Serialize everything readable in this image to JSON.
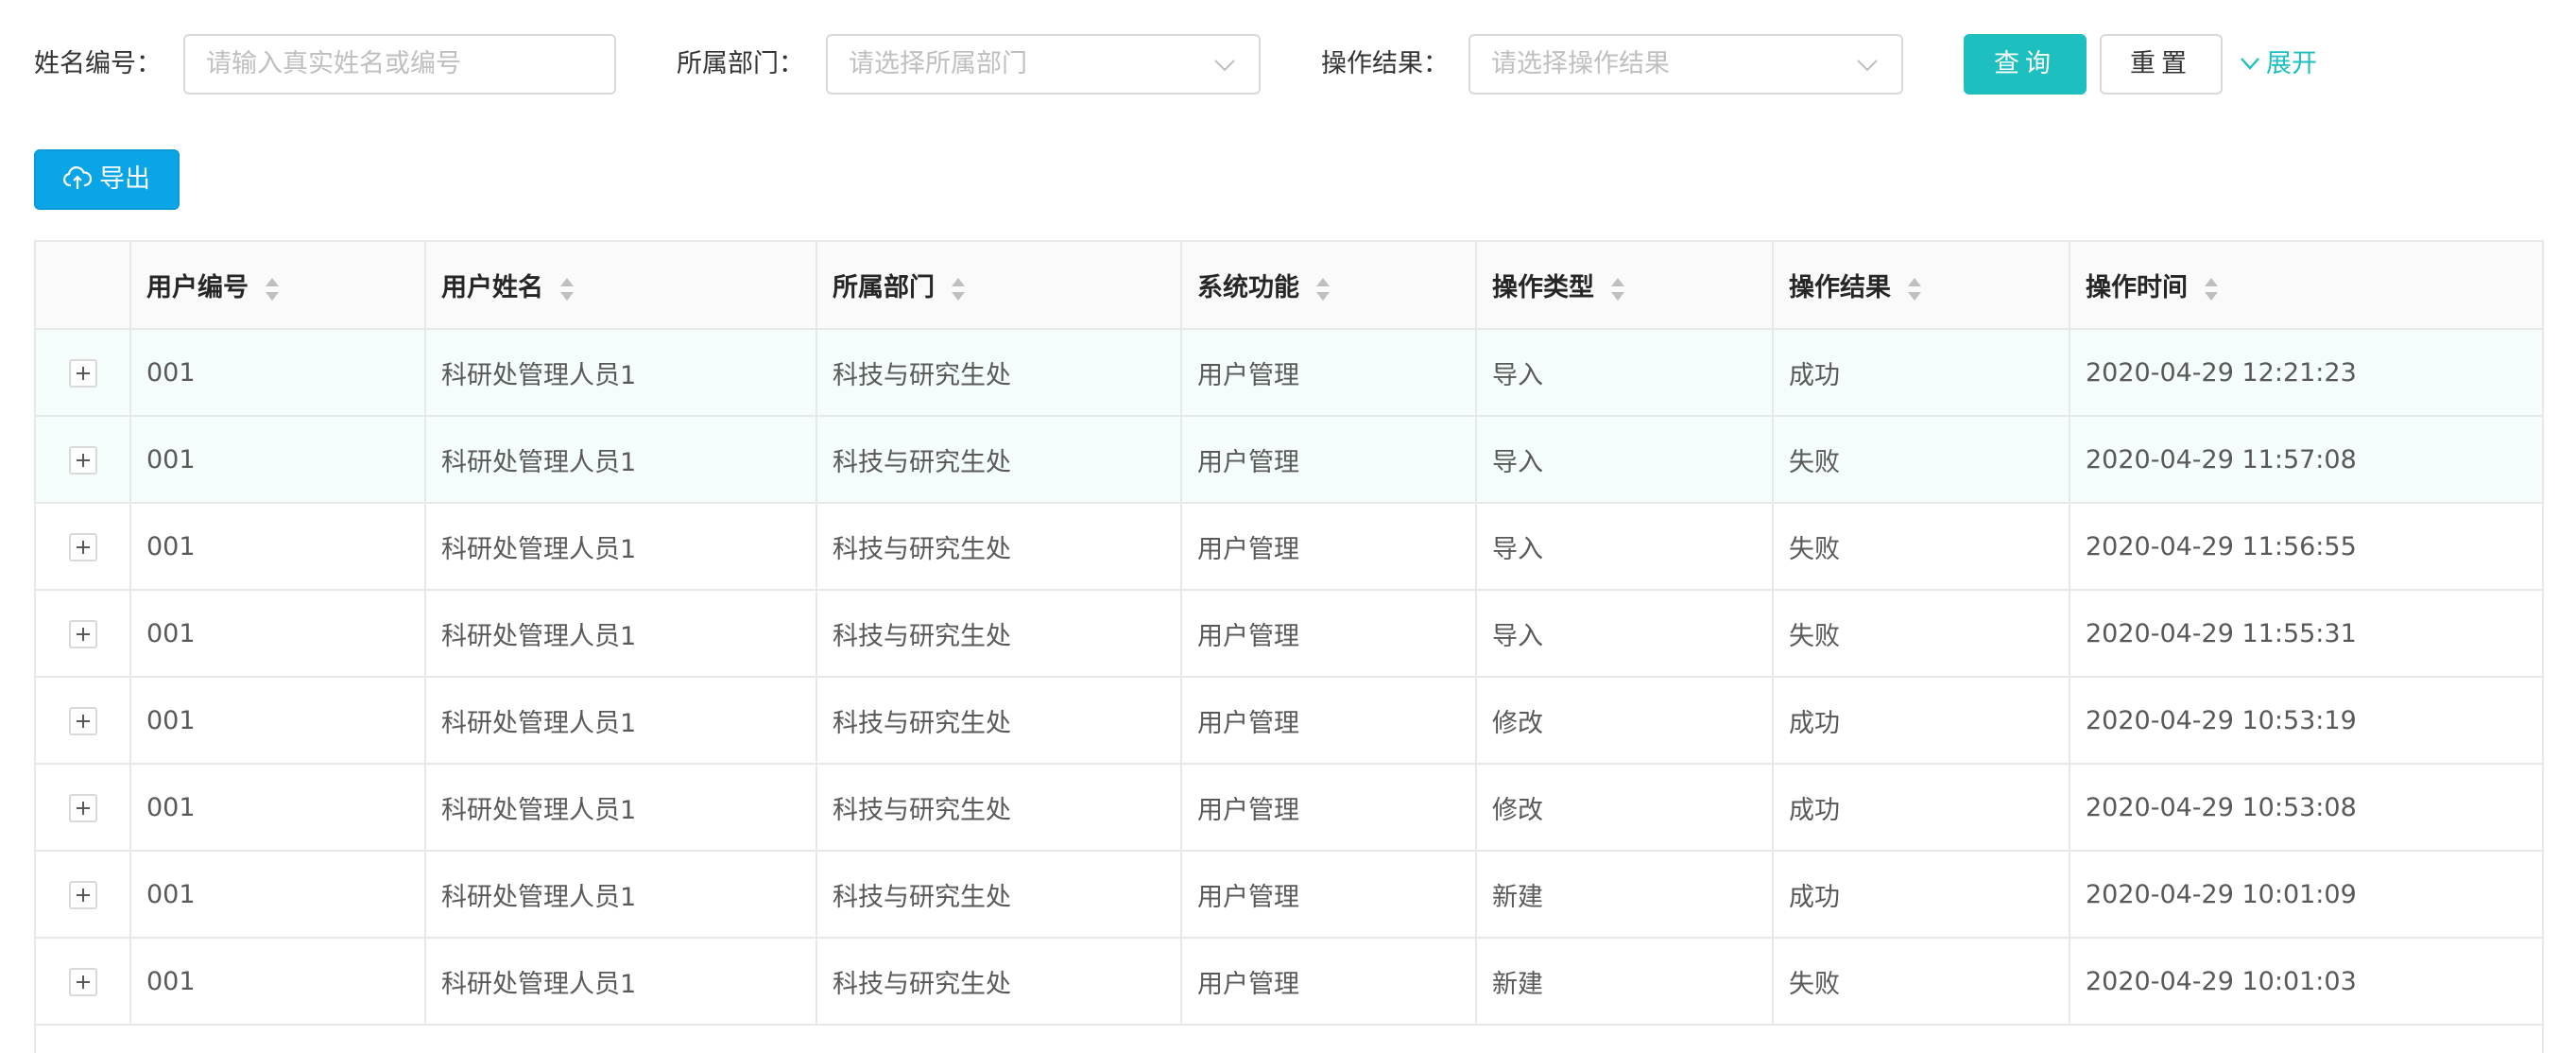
{
  "search": {
    "name_label": "姓名编号：",
    "name_placeholder": "请输入真实姓名或编号",
    "dept_label": "所属部门：",
    "dept_placeholder": "请选择所属部门",
    "result_label": "操作结果：",
    "result_placeholder": "请选择操作结果",
    "query_label": "查询",
    "reset_label": "重置",
    "expand_label": "展开"
  },
  "toolbar": {
    "export_label": "导出"
  },
  "colors": {
    "accent": "#1dbfbf",
    "export": "#0aa5e6",
    "row_highlight": "#f4fcfc"
  },
  "table": {
    "headers": [
      "用户编号",
      "用户姓名",
      "所属部门",
      "系统功能",
      "操作类型",
      "操作结果",
      "操作时间"
    ],
    "rows": [
      [
        "001",
        "科研处管理人员1",
        "科技与研究生处",
        "用户管理",
        "导入",
        "成功",
        "2020-04-29 12:21:23"
      ],
      [
        "001",
        "科研处管理人员1",
        "科技与研究生处",
        "用户管理",
        "导入",
        "失败",
        "2020-04-29 11:57:08"
      ],
      [
        "001",
        "科研处管理人员1",
        "科技与研究生处",
        "用户管理",
        "导入",
        "失败",
        "2020-04-29 11:56:55"
      ],
      [
        "001",
        "科研处管理人员1",
        "科技与研究生处",
        "用户管理",
        "导入",
        "失败",
        "2020-04-29 11:55:31"
      ],
      [
        "001",
        "科研处管理人员1",
        "科技与研究生处",
        "用户管理",
        "修改",
        "成功",
        "2020-04-29 10:53:19"
      ],
      [
        "001",
        "科研处管理人员1",
        "科技与研究生处",
        "用户管理",
        "修改",
        "成功",
        "2020-04-29 10:53:08"
      ],
      [
        "001",
        "科研处管理人员1",
        "科技与研究生处",
        "用户管理",
        "新建",
        "成功",
        "2020-04-29 10:01:09"
      ],
      [
        "001",
        "科研处管理人员1",
        "科技与研究生处",
        "用户管理",
        "新建",
        "失败",
        "2020-04-29 10:01:03"
      ]
    ]
  }
}
